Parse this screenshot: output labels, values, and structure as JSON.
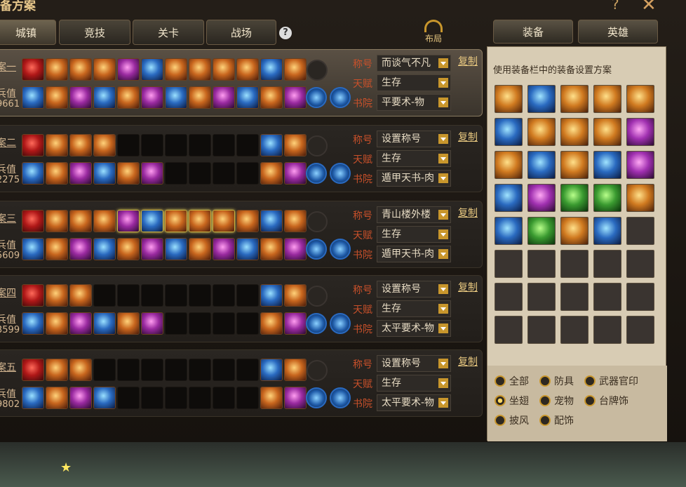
{
  "window": {
    "title": "备方案",
    "help_glyph": "?",
    "close_glyph": "✕"
  },
  "tabs": [
    {
      "label": "城镇"
    },
    {
      "label": "竞技"
    },
    {
      "label": "关卡"
    },
    {
      "label": "战场"
    }
  ],
  "help": "?",
  "layout_button": {
    "label": "布局"
  },
  "right_tabs": [
    {
      "label": "装备"
    },
    {
      "label": "英雄"
    }
  ],
  "field_labels": {
    "title": "称号",
    "talent": "天赋",
    "academy": "书院"
  },
  "copy_label": "复制",
  "power_label": "兵值",
  "plans": [
    {
      "name": "案一",
      "power": "9661",
      "title": "而谈气不凡",
      "talent": "生存",
      "academy": "平要术-物"
    },
    {
      "name": "案二",
      "power": "2275",
      "title": "设置称号",
      "talent": "生存",
      "academy": "遁甲天书-肉"
    },
    {
      "name": "案三",
      "power": "5609",
      "title": "青山楼外楼",
      "talent": "生存",
      "academy": "遁甲天书-肉"
    },
    {
      "name": "案四",
      "power": "3599",
      "title": "设置称号",
      "talent": "生存",
      "academy": "太平要术-物"
    },
    {
      "name": "案五",
      "power": "9802",
      "title": "设置称号",
      "talent": "生存",
      "academy": "太平要术-物"
    }
  ],
  "right_panel": {
    "hint": "使用装备栏中的装备设置方案",
    "filters": [
      {
        "label": "全部",
        "checked": false
      },
      {
        "label": "防具",
        "checked": false
      },
      {
        "label": "武器官印",
        "checked": false
      },
      {
        "label": "坐翅",
        "checked": true
      },
      {
        "label": "宠物",
        "checked": false
      },
      {
        "label": "台牌饰",
        "checked": false
      },
      {
        "label": "披风",
        "checked": false
      },
      {
        "label": "配饰",
        "checked": false
      }
    ]
  }
}
